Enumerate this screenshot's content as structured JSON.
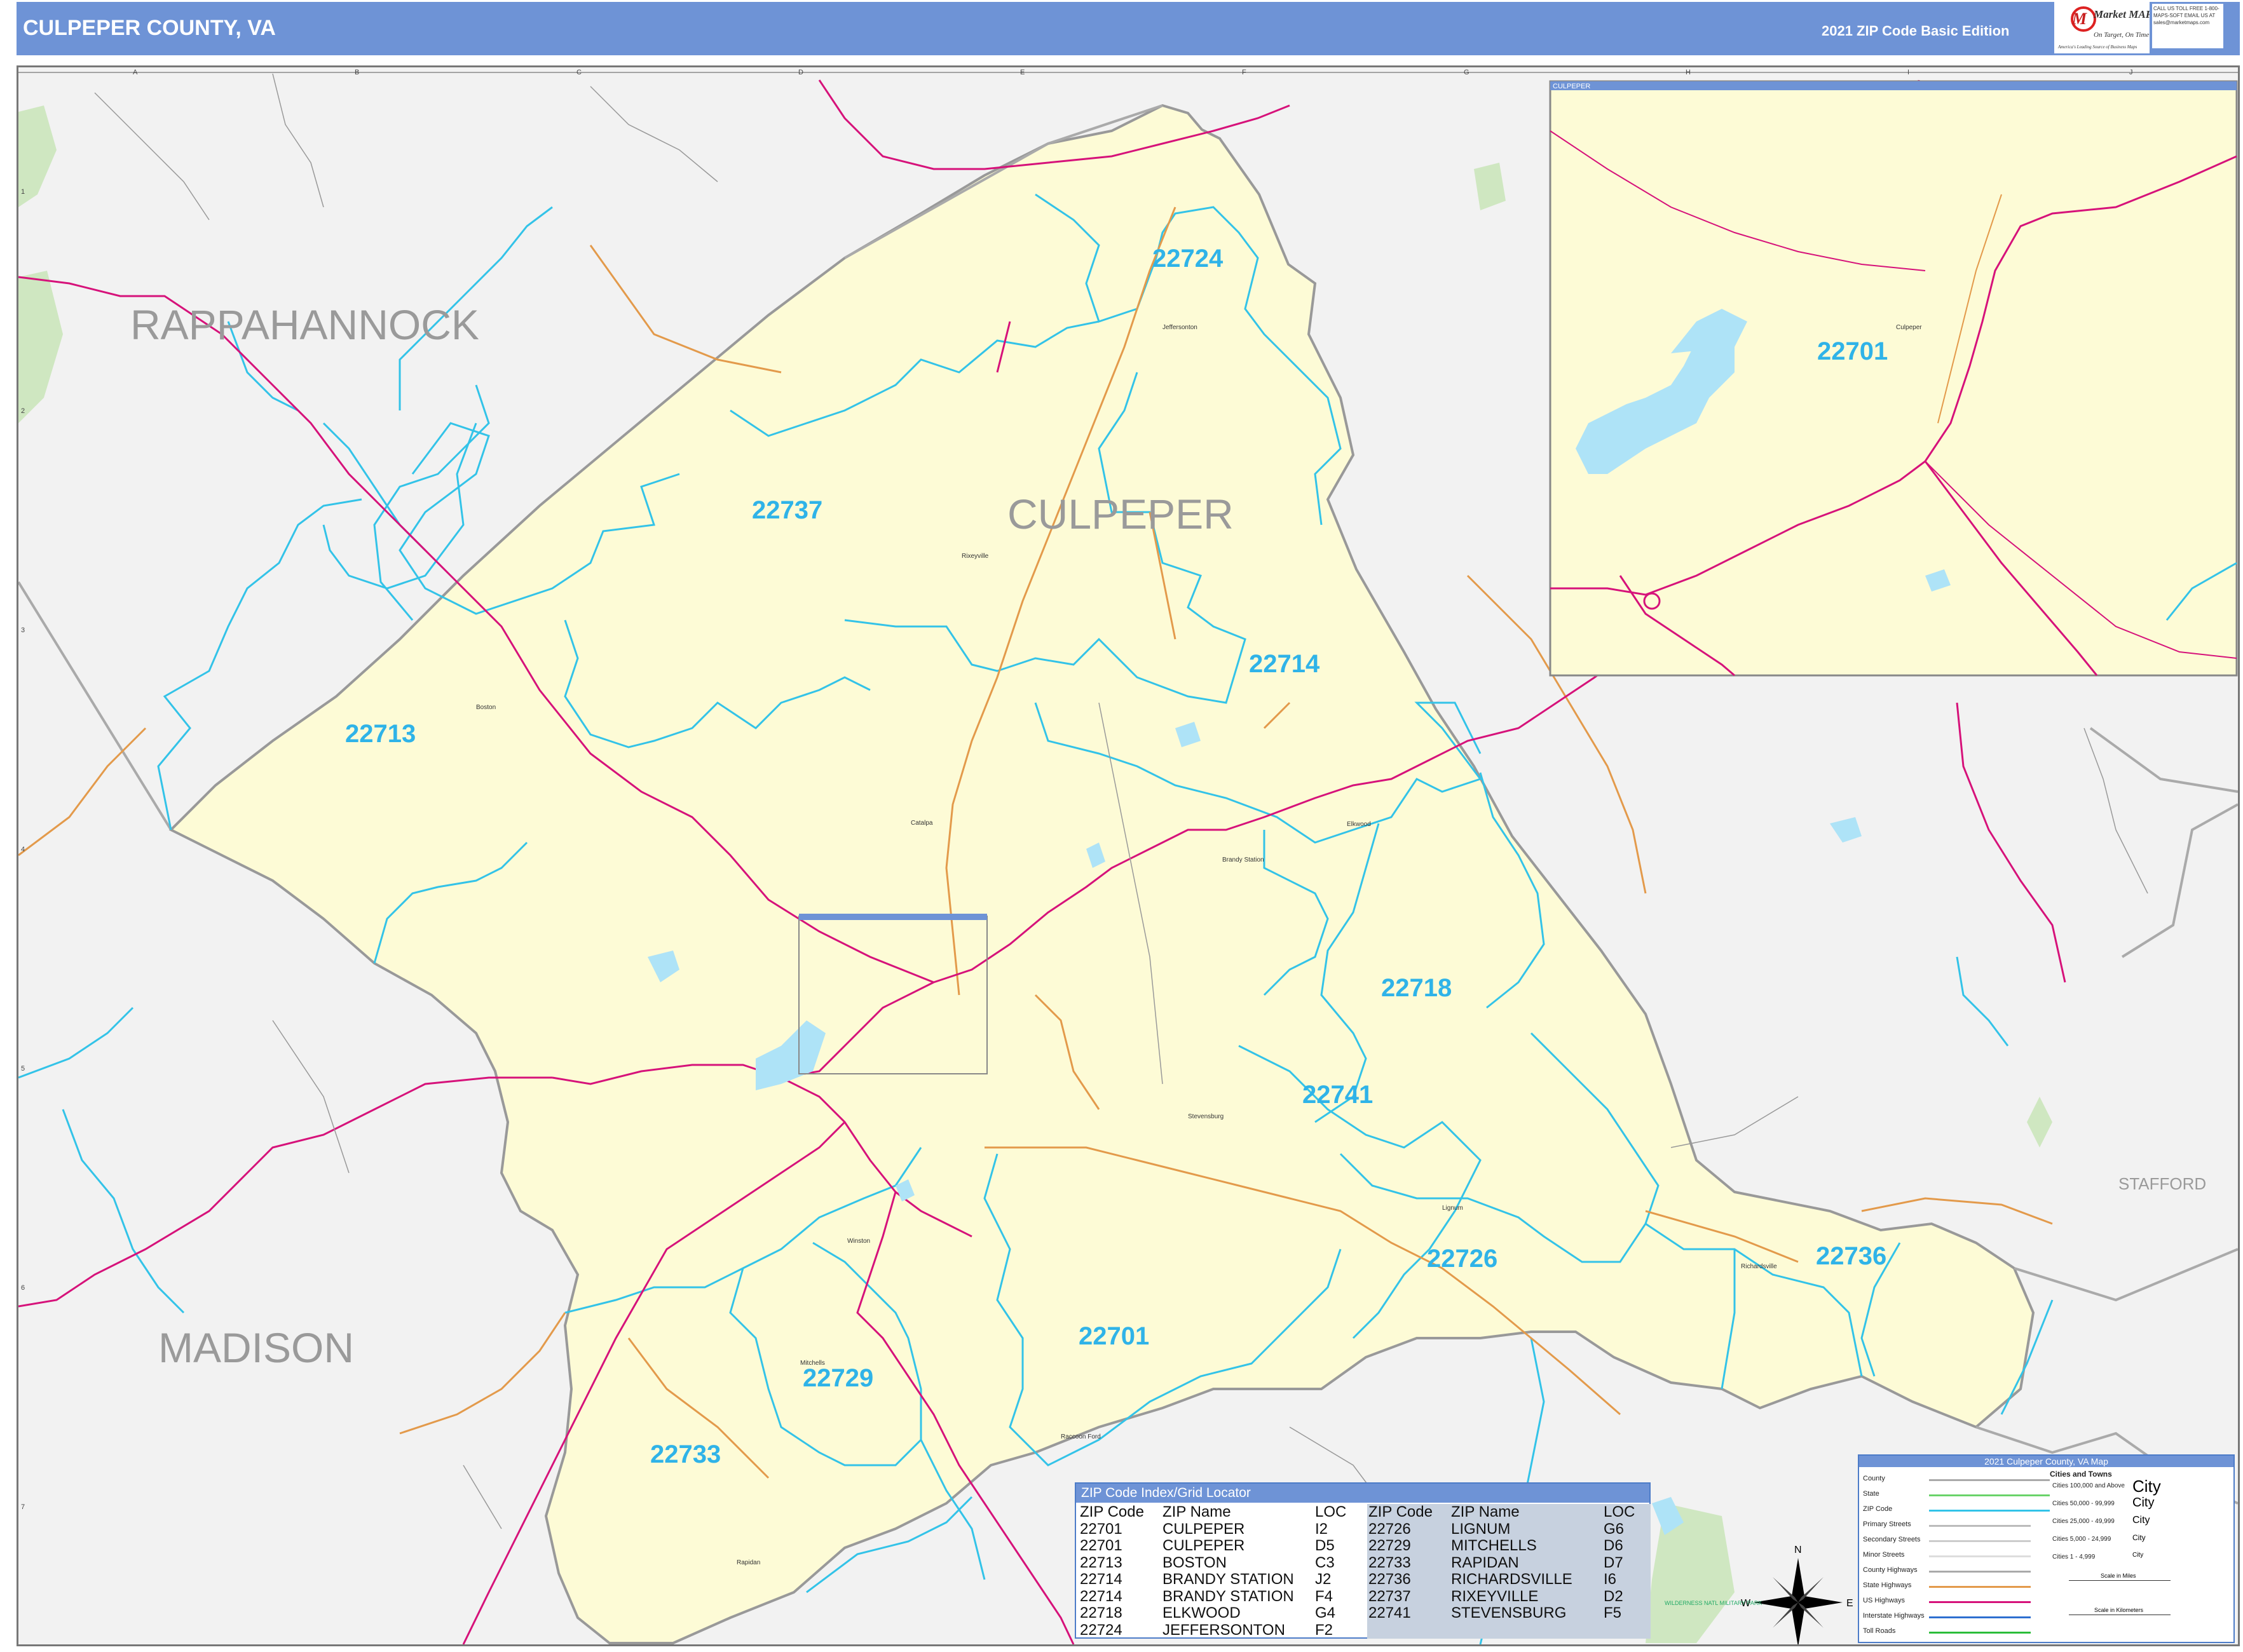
{
  "header": {
    "title": "CULPEPER COUNTY, VA",
    "edition": "2021 ZIP Code Basic Edition",
    "logo_text": "Market MAPS",
    "logo_tagline": "On Target, On Time",
    "logo_subtagline": "America's Leading Source of Business Maps",
    "call_text": "CALL US TOLL FREE 1-800-MAPS-SOFT  EMAIL US AT sales@marketmaps.com"
  },
  "grid": {
    "columns": [
      "A",
      "B",
      "C",
      "D",
      "E",
      "F",
      "G",
      "H",
      "I",
      "J"
    ],
    "rows": [
      "1",
      "2",
      "3",
      "4",
      "5",
      "6",
      "7"
    ]
  },
  "counties": {
    "rappahannock": "RAPPAHANNOCK",
    "culpeper": "CULPEPER",
    "madison": "MADISON",
    "stafford": "STAFFORD"
  },
  "zip_labels": {
    "z22724": "22724",
    "z22737": "22737",
    "z22713": "22713",
    "z22714": "22714",
    "z22718": "22718",
    "z22741": "22741",
    "z22726": "22726",
    "z22736": "22736",
    "z22701": "22701",
    "z22729": "22729",
    "z22733": "22733",
    "z22701_inset": "22701"
  },
  "places": {
    "jeffersonton": "Jeffersonton",
    "rixeyville": "Rixeyville",
    "boston": "Boston",
    "catalpa": "Catalpa",
    "brandy_station": "Brandy Station",
    "elkwood": "Elkwood",
    "stevensburg": "Stevensburg",
    "lignum": "Lignum",
    "richardsville": "Richardsville",
    "winston": "Winston",
    "mitchells": "Mitchells",
    "raccoon_ford": "Raccoon Ford",
    "rapidan": "Rapidan",
    "culpeper_inset": "Culpeper",
    "wilderness": "WILDERNESS NATL MILITARY PARK"
  },
  "inset": {
    "title": "CULPEPER"
  },
  "zip_index": {
    "title": "ZIP Code Index/Grid Locator",
    "headers": {
      "zip": "ZIP Code",
      "name": "ZIP Name",
      "loc": "LOC"
    },
    "left_rows": [
      {
        "zip": "22701",
        "name": "CULPEPER",
        "loc": "I2"
      },
      {
        "zip": "22701",
        "name": "CULPEPER",
        "loc": "D5"
      },
      {
        "zip": "22713",
        "name": "BOSTON",
        "loc": "C3"
      },
      {
        "zip": "22714",
        "name": "BRANDY STATION",
        "loc": "J2"
      },
      {
        "zip": "22714",
        "name": "BRANDY STATION",
        "loc": "F4"
      },
      {
        "zip": "22718",
        "name": "ELKWOOD",
        "loc": "G4"
      },
      {
        "zip": "22724",
        "name": "JEFFERSONTON",
        "loc": "F2"
      }
    ],
    "right_rows": [
      {
        "zip": "22726",
        "name": "LIGNUM",
        "loc": "G6"
      },
      {
        "zip": "22729",
        "name": "MITCHELLS",
        "loc": "D6"
      },
      {
        "zip": "22733",
        "name": "RAPIDAN",
        "loc": "D7"
      },
      {
        "zip": "22736",
        "name": "RICHARDSVILLE",
        "loc": "I6"
      },
      {
        "zip": "22737",
        "name": "RIXEYVILLE",
        "loc": "D2"
      },
      {
        "zip": "22741",
        "name": "STEVENSBURG",
        "loc": "F5"
      }
    ]
  },
  "legend": {
    "title": "2021 Culpeper County, VA Map",
    "cities_title": "Cities and Towns",
    "items": [
      "County",
      "State",
      "ZIP Code",
      "Primary Streets",
      "Secondary Streets",
      "Minor Streets",
      "County Highways",
      "State Highways",
      "US Highways",
      "Interstate Highways",
      "Toll Roads"
    ],
    "cities": [
      "Cities 100,000 and Above",
      "Cities 50,000 - 99,999",
      "Cities 25,000 - 49,999",
      "Cities 5,000 - 24,999",
      "Cities 1 - 4,999"
    ],
    "city_symbols": [
      "City",
      "City",
      "City",
      "City",
      "City"
    ],
    "scale_miles": "Scale in Miles",
    "scale_km": "Scale in Kilometers"
  },
  "compass": {
    "n": "N",
    "s": "S",
    "e": "E",
    "w": "W"
  },
  "colors": {
    "header": "#6e93d6",
    "county_fill": "#fdfbd6",
    "zip_boundary": "#33c3e8",
    "us_highway": "#d6127a",
    "state_highway": "#e39a4b",
    "county_line": "#999999",
    "water": "#aee3f7",
    "park": "#cfe7c1",
    "zip_label": "#2fb3e8"
  }
}
